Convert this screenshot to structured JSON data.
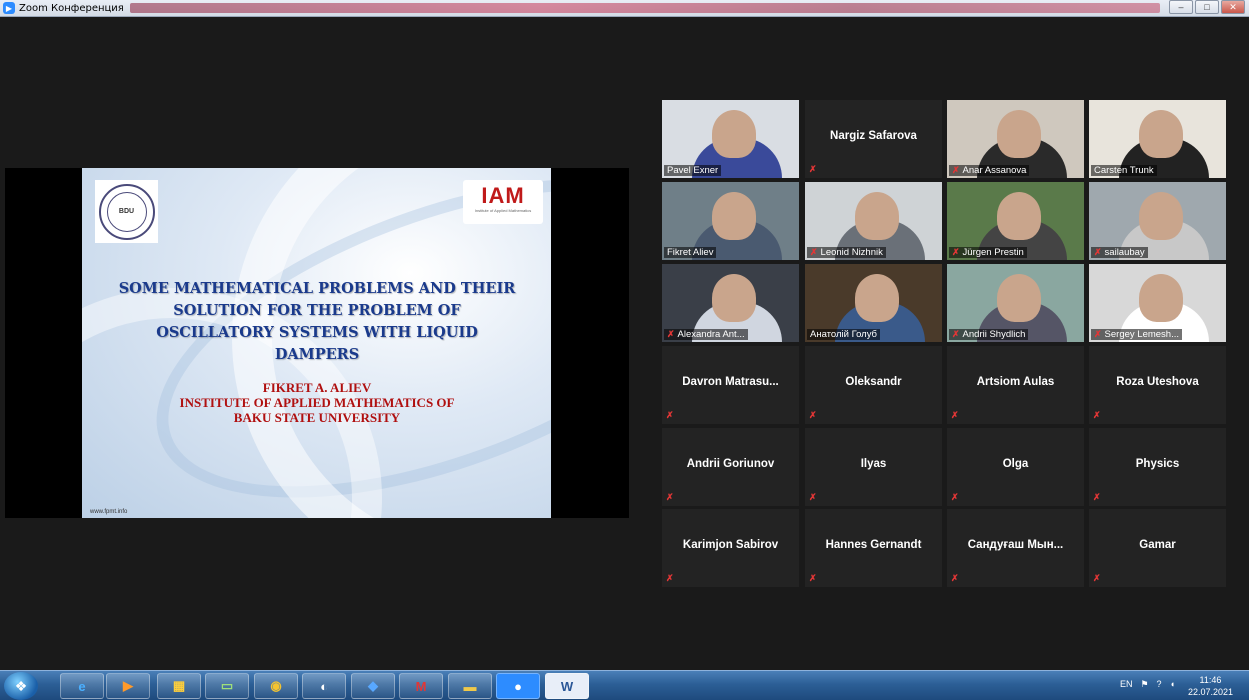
{
  "window": {
    "title": "Zoom Конференция",
    "minimize": "–",
    "maximize": "□",
    "close": "✕"
  },
  "slide": {
    "title": "SOME MATHEMATICAL PROBLEMS AND THEIR SOLUTION FOR THE PROBLEM OF OSCILLATORY SYSTEMS WITH LIQUID DAMPERS",
    "author": "FIKRET A. ALIEV",
    "affiliation1": "INSTITUTE OF APPLIED MATHEMATICS OF",
    "affiliation2": "BAKU STATE UNIVERSITY",
    "logo_left_text": "BDU",
    "logo_right_text": "IAM",
    "logo_right_sub": "Institute of Applied Mathematics",
    "url": "www.fpmt.info"
  },
  "participants": [
    {
      "name": "Pavel Exner",
      "video": true,
      "muted": false
    },
    {
      "name": "Nargiz Safarova",
      "video": false,
      "muted": true
    },
    {
      "name": "Anar Assanova",
      "video": true,
      "muted": true
    },
    {
      "name": "Carsten Trunk",
      "video": true,
      "muted": false,
      "active": true
    },
    {
      "name": "Fikret Aliev",
      "video": true,
      "muted": false
    },
    {
      "name": "Leonid Nizhnik",
      "video": true,
      "muted": true
    },
    {
      "name": "Jürgen Prestin",
      "video": true,
      "muted": true
    },
    {
      "name": "sailaubay",
      "video": true,
      "muted": true
    },
    {
      "name": "Alexandra Ant...",
      "video": true,
      "muted": true
    },
    {
      "name": "Анатолій Голуб",
      "video": true,
      "muted": false
    },
    {
      "name": "Andrii Shydlich",
      "video": true,
      "muted": true
    },
    {
      "name": "Sergey Lemesh...",
      "video": true,
      "muted": true
    },
    {
      "name": "Davron  Matrasu...",
      "video": false,
      "muted": true
    },
    {
      "name": "Oleksandr",
      "video": false,
      "muted": true
    },
    {
      "name": "Artsiom Aulas",
      "video": false,
      "muted": true
    },
    {
      "name": "Roza Uteshova",
      "video": false,
      "muted": true
    },
    {
      "name": "Andrii Goriunov",
      "video": false,
      "muted": true
    },
    {
      "name": "Ilyas",
      "video": false,
      "muted": true
    },
    {
      "name": "Olga",
      "video": false,
      "muted": true
    },
    {
      "name": "Physics",
      "video": false,
      "muted": true
    },
    {
      "name": "Karimjon Sabirov",
      "video": false,
      "muted": true
    },
    {
      "name": "Hannes Gernandt",
      "video": false,
      "muted": true
    },
    {
      "name": "Сандуғаш  Мын...",
      "video": false,
      "muted": true
    },
    {
      "name": "Gamar",
      "video": false,
      "muted": true
    }
  ],
  "taskbar": {
    "apps": [
      "ie-icon",
      "media-player-icon",
      "apps-grid-icon",
      "monitor-icon",
      "chrome-icon",
      "skype-icon",
      "dropbox-icon",
      "mcafee-icon",
      "folder-icon",
      "zoom-icon",
      "word-icon"
    ],
    "lang": "EN",
    "time": "11:46",
    "date": "22.07.2021"
  }
}
